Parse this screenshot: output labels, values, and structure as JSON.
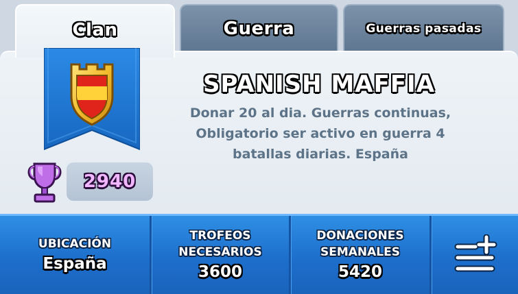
{
  "tabs": [
    {
      "label": "Clan",
      "active": true
    },
    {
      "label": "Guerra",
      "active": false
    },
    {
      "label": "Guerras pasadas",
      "active": false
    }
  ],
  "clan": {
    "name": "SPANISH MAFFIA",
    "description_lines": [
      "Donar 20 al dia. Guerras continuas,",
      "Obligatorio ser activo en guerra 4",
      "batallas diarias. España"
    ],
    "trophies": "2940",
    "badge_icon": "clan-badge-icon",
    "trophy_icon": "trophy-icon"
  },
  "stats": {
    "location": {
      "label": "UBICACIÓN",
      "value": "España"
    },
    "required_trophies": {
      "label_lines": [
        "TROFEOS",
        "NECESARIOS"
      ],
      "value": "3600"
    },
    "weekly_donations": {
      "label_lines": [
        "DONACIONES",
        "SEMANALES"
      ],
      "value": "5420"
    },
    "menu_icon": "add-list-icon"
  },
  "colors": {
    "stats_bar": "#1d6fcc",
    "banner": "#1f7ad6",
    "trophy_purple": "#c06de8"
  }
}
